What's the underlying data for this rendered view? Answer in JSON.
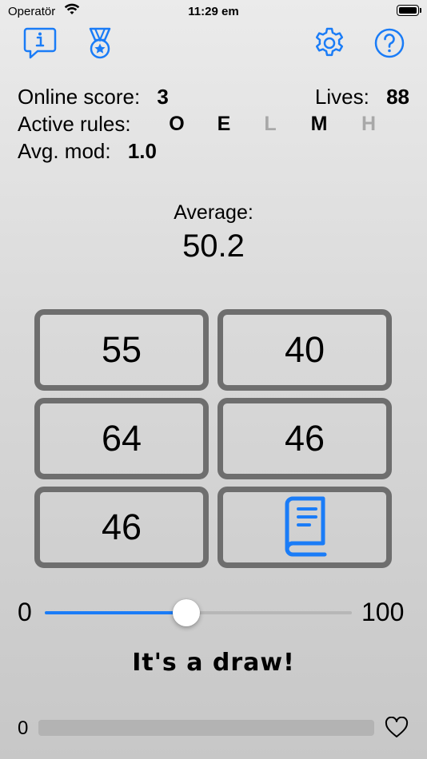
{
  "status_bar": {
    "carrier": "Operatör",
    "time": "11:29 em"
  },
  "toolbar": {
    "left_icons": [
      "info-bubble-icon",
      "medal-icon"
    ],
    "right_icons": [
      "gear-icon",
      "help-icon"
    ],
    "accent_color": "#1a7cf7"
  },
  "stats": {
    "online_score_label": "Online score:",
    "online_score_value": "3",
    "lives_label": "Lives:",
    "lives_value": "88",
    "active_rules_label": "Active rules:",
    "rules": [
      {
        "letter": "O",
        "active": true
      },
      {
        "letter": "E",
        "active": true
      },
      {
        "letter": "L",
        "active": false
      },
      {
        "letter": "M",
        "active": true
      },
      {
        "letter": "H",
        "active": false
      }
    ],
    "avg_mod_label": "Avg. mod:",
    "avg_mod_value": "1.0"
  },
  "average": {
    "label": "Average:",
    "value": "50.2"
  },
  "cards": [
    {
      "value": "55"
    },
    {
      "value": "40"
    },
    {
      "value": "64"
    },
    {
      "value": "46"
    },
    {
      "value": "46"
    },
    {
      "icon": "book-icon"
    }
  ],
  "slider": {
    "min_label": "0",
    "max_label": "100",
    "value": 46
  },
  "result_text": "It's a draw!",
  "progress": {
    "value_label": "0",
    "fraction": 0,
    "icon": "heart-icon"
  },
  "colors": {
    "active_rule": "#000000",
    "inactive_rule": "#a8a8a8",
    "card_border": "#6e6e6e"
  }
}
